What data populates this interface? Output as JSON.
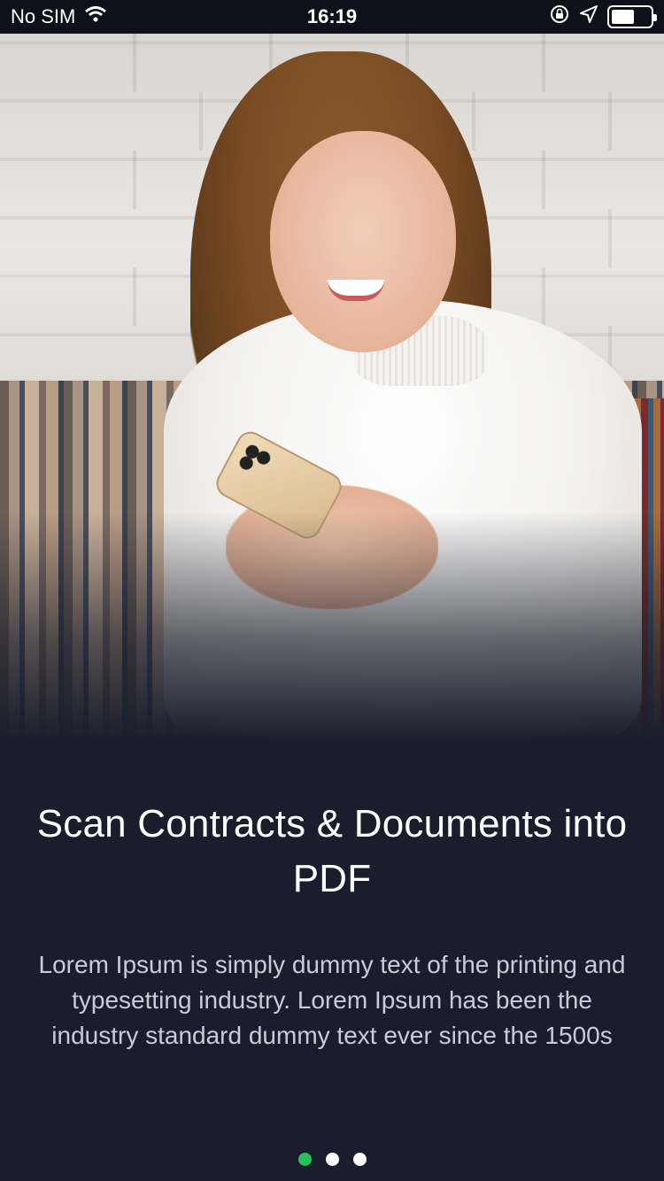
{
  "status_bar": {
    "carrier": "No SIM",
    "time": "16:19",
    "wifi_icon": "wifi-icon",
    "lock_icon": "orientation-lock-icon",
    "location_icon": "location-arrow-icon",
    "battery_icon": "battery-icon",
    "battery_level": 0.6
  },
  "onboarding": {
    "title": "Scan Contracts & Documents into PDF",
    "description": "Lorem Ipsum is simply dummy text of the printing and typesetting industry. Lorem Ipsum has been the industry standard dummy text ever since the 1500s"
  },
  "pagination": {
    "total": 3,
    "active_index": 0,
    "active_color": "#27c15a",
    "inactive_color": "#ffffff"
  },
  "colors": {
    "background": "#1a1d2b",
    "status_bar": "#0f111a"
  }
}
